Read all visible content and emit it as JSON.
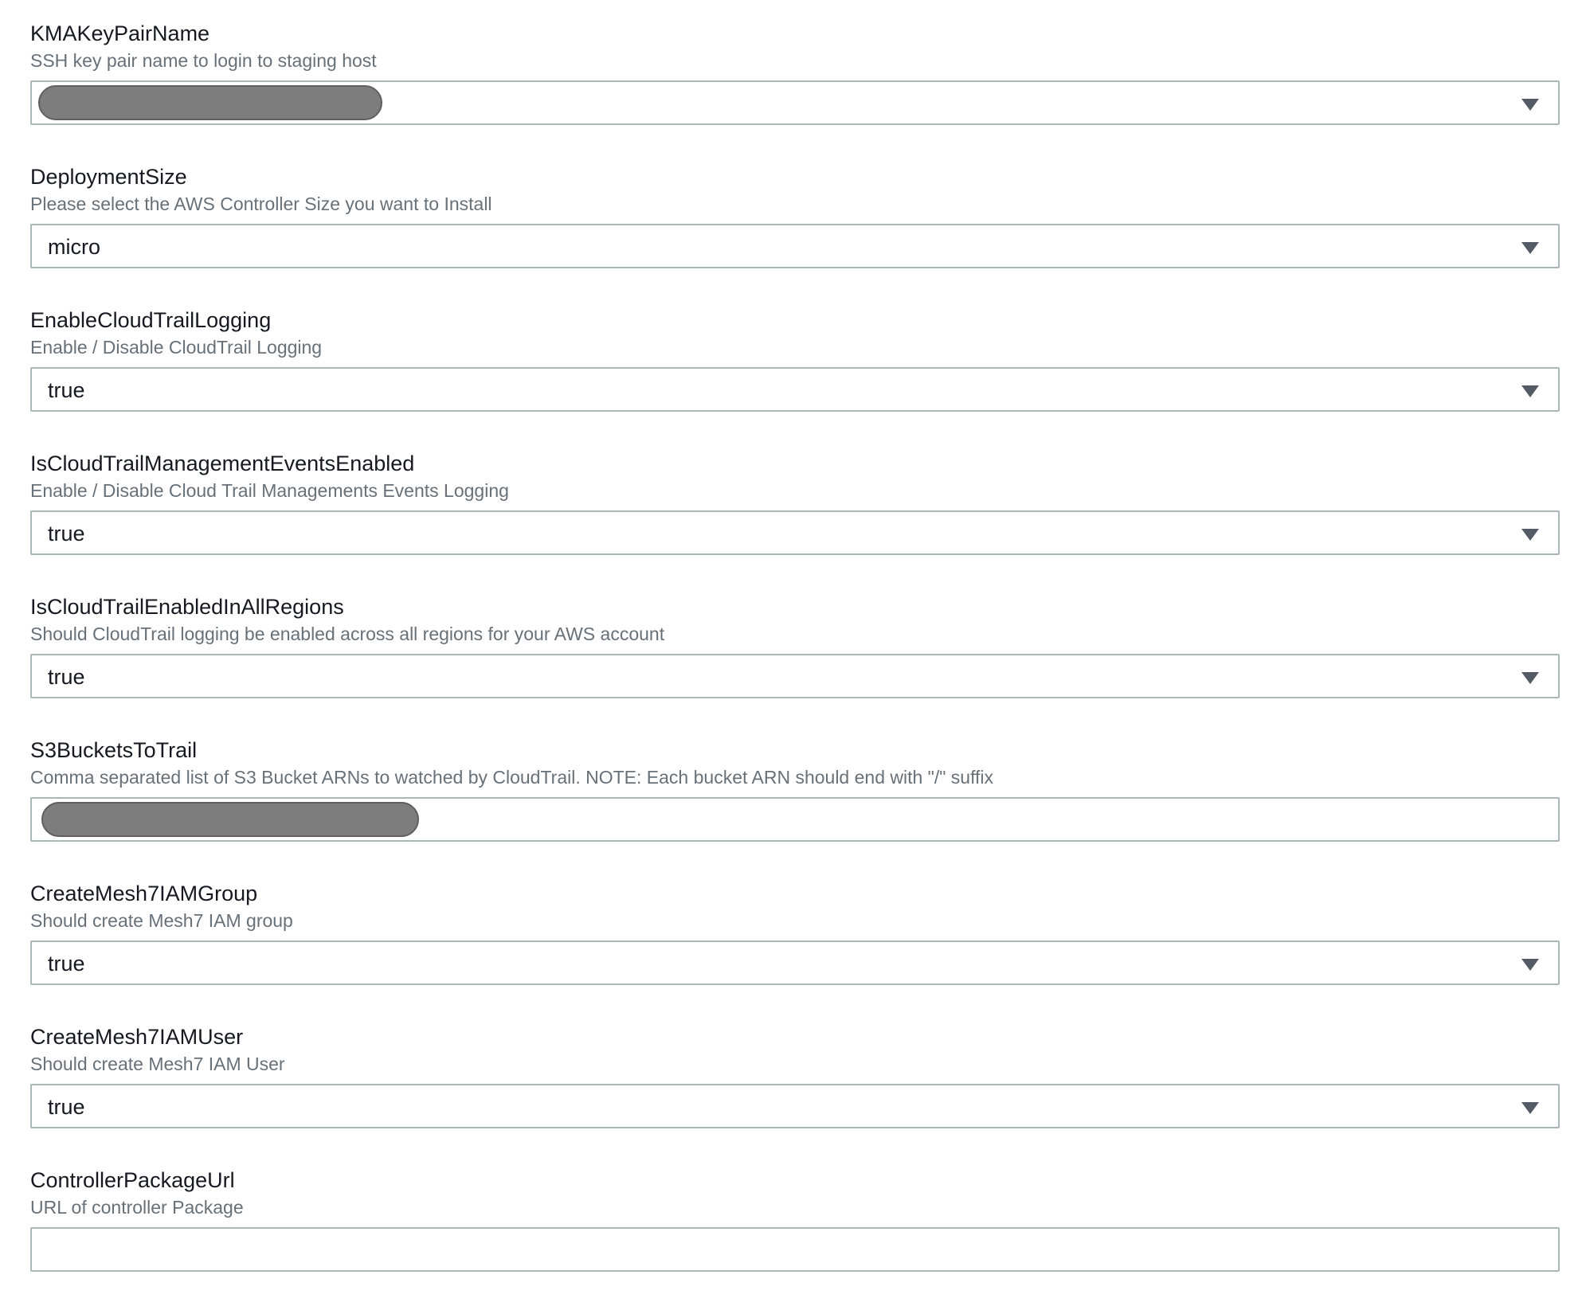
{
  "params": [
    {
      "label": "KMAKeyPairName",
      "description": "SSH key pair name to login to staging host",
      "value": "",
      "type": "select",
      "redacted": true
    },
    {
      "label": "DeploymentSize",
      "description": "Please select the AWS Controller Size you want to Install",
      "value": "micro",
      "type": "select"
    },
    {
      "label": "EnableCloudTrailLogging",
      "description": "Enable / Disable CloudTrail Logging",
      "value": "true",
      "type": "select"
    },
    {
      "label": "IsCloudTrailManagementEventsEnabled",
      "description": "Enable / Disable Cloud Trail Managements Events Logging",
      "value": "true",
      "type": "select"
    },
    {
      "label": "IsCloudTrailEnabledInAllRegions",
      "description": "Should CloudTrail logging be enabled across all regions for your AWS account",
      "value": "true",
      "type": "select"
    },
    {
      "label": "S3BucketsToTrail",
      "description": "Comma separated list of S3 Bucket ARNs to watched by CloudTrail. NOTE: Each bucket ARN should end with \"/\" suffix",
      "value": "",
      "type": "text",
      "redacted": true
    },
    {
      "label": "CreateMesh7IAMGroup",
      "description": "Should create Mesh7 IAM group",
      "value": "true",
      "type": "select"
    },
    {
      "label": "CreateMesh7IAMUser",
      "description": "Should create Mesh7 IAM User",
      "value": "true",
      "type": "select"
    },
    {
      "label": "ControllerPackageUrl",
      "description": "URL of controller Package",
      "value": "",
      "type": "text"
    }
  ],
  "icons": {
    "select_caret": "caret-down-icon"
  },
  "colors": {
    "label": "#16191f",
    "description": "#687078",
    "border": "#aab7b8",
    "caret": "#545b64",
    "redaction": "#7d7d7d"
  }
}
